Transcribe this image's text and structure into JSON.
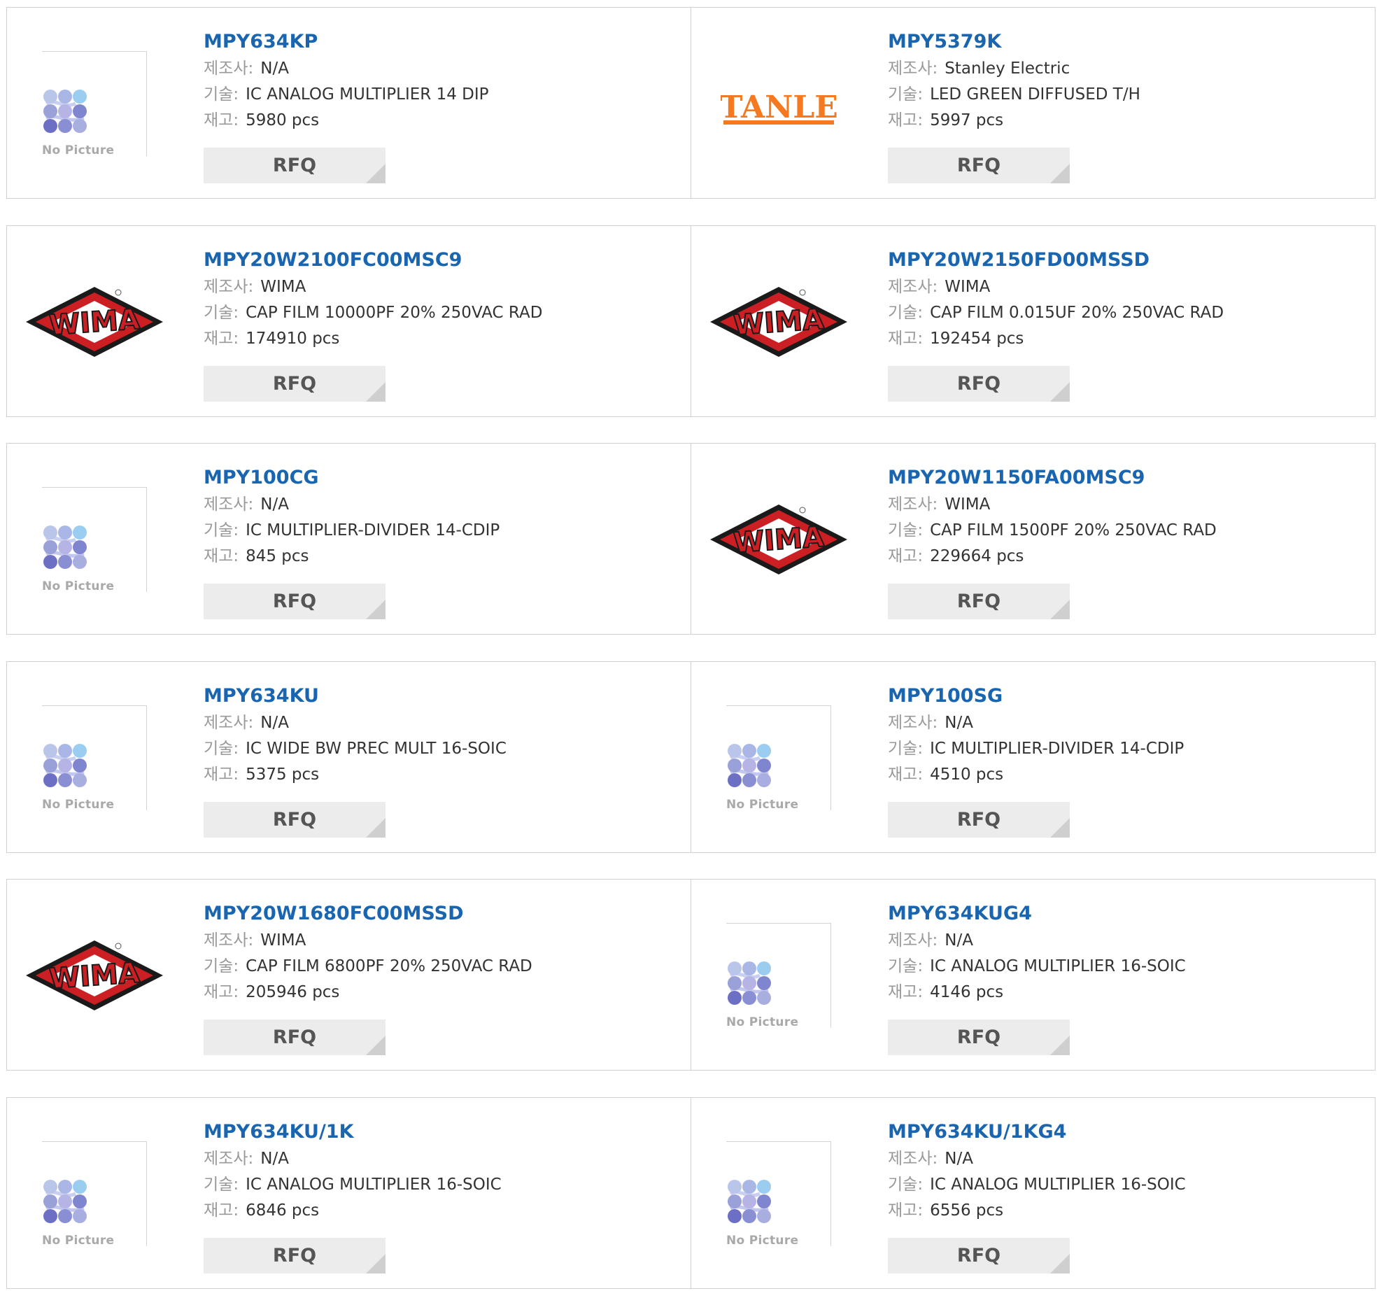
{
  "labels": {
    "manufacturer": "제조사:",
    "description": "기술:",
    "stock": "재고:"
  },
  "rfq_label": "RFQ",
  "no_picture_label": "No Picture",
  "colors": {
    "part_link": "#1a65b0",
    "label": "#999999",
    "value": "#333333",
    "rfq_bg": "#ececec",
    "wima_red": "#cc1f24",
    "stanley_orange": "#f47920"
  },
  "products": [
    {
      "part": "MPY634KP",
      "manufacturer": "N/A",
      "description": "IC ANALOG MULTIPLIER 14 DIP",
      "stock": "5980 pcs",
      "image": "no-picture"
    },
    {
      "part": "MPY5379K",
      "manufacturer": "Stanley Electric",
      "description": "LED GREEN DIFFUSED T/H",
      "stock": "5997 pcs",
      "image": "stanley-logo",
      "logo_text": "STANLEY"
    },
    {
      "part": "MPY20W2100FC00MSC9",
      "manufacturer": "WIMA",
      "description": "CAP FILM 10000PF 20% 250VAC RAD",
      "stock": "174910 pcs",
      "image": "wima-logo",
      "logo_text": "WIMA"
    },
    {
      "part": "MPY20W2150FD00MSSD",
      "manufacturer": "WIMA",
      "description": "CAP FILM 0.015UF 20% 250VAC RAD",
      "stock": "192454 pcs",
      "image": "wima-logo",
      "logo_text": "WIMA"
    },
    {
      "part": "MPY100CG",
      "manufacturer": "N/A",
      "description": "IC MULTIPLIER-DIVIDER 14-CDIP",
      "stock": "845 pcs",
      "image": "no-picture"
    },
    {
      "part": "MPY20W1150FA00MSC9",
      "manufacturer": "WIMA",
      "description": "CAP FILM 1500PF 20% 250VAC RAD",
      "stock": "229664 pcs",
      "image": "wima-logo",
      "logo_text": "WIMA"
    },
    {
      "part": "MPY634KU",
      "manufacturer": "N/A",
      "description": "IC WIDE BW PREC MULT 16-SOIC",
      "stock": "5375 pcs",
      "image": "no-picture"
    },
    {
      "part": "MPY100SG",
      "manufacturer": "N/A",
      "description": "IC MULTIPLIER-DIVIDER 14-CDIP",
      "stock": "4510 pcs",
      "image": "no-picture"
    },
    {
      "part": "MPY20W1680FC00MSSD",
      "manufacturer": "WIMA",
      "description": "CAP FILM 6800PF 20% 250VAC RAD",
      "stock": "205946 pcs",
      "image": "wima-logo",
      "logo_text": "WIMA"
    },
    {
      "part": "MPY634KUG4",
      "manufacturer": "N/A",
      "description": "IC ANALOG MULTIPLIER 16-SOIC",
      "stock": "4146 pcs",
      "image": "no-picture"
    },
    {
      "part": "MPY634KU/1K",
      "manufacturer": "N/A",
      "description": "IC ANALOG MULTIPLIER 16-SOIC",
      "stock": "6846 pcs",
      "image": "no-picture"
    },
    {
      "part": "MPY634KU/1KG4",
      "manufacturer": "N/A",
      "description": "IC ANALOG MULTIPLIER 16-SOIC",
      "stock": "6556 pcs",
      "image": "no-picture"
    }
  ]
}
